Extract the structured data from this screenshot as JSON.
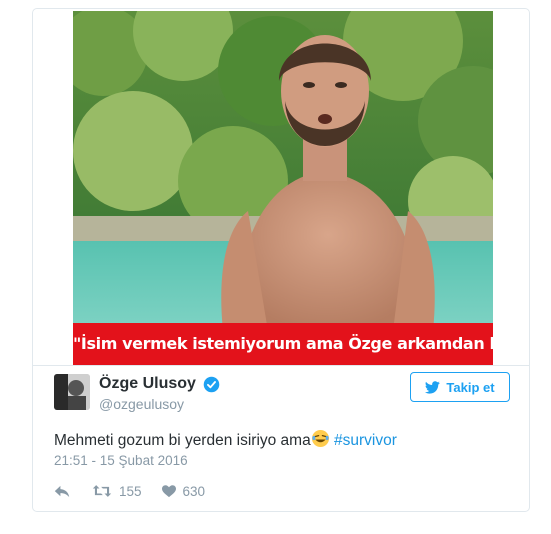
{
  "media": {
    "caption": "\"İsim vermek istemiyorum ama Özge arkamdan konuşmuş.\""
  },
  "author": {
    "name": "Özge Ulusoy",
    "handle": "@ozgeulusoy",
    "verified": true
  },
  "follow_button": {
    "label": "Takip et",
    "icon": "twitter-bird-icon"
  },
  "tweet": {
    "text": "Mehmeti gozum bi yerden isiriyo ama",
    "emoji": "😂",
    "hashtag": "#survivor",
    "timestamp": "21:51 - 15 Şubat 2016"
  },
  "actions": {
    "reply_icon": "reply-icon",
    "retweet_icon": "retweet-icon",
    "retweets": "155",
    "like_icon": "heart-icon",
    "likes": "630"
  },
  "colors": {
    "accent": "#1da1f2",
    "hashtag": "#1b95e0",
    "caption_bg": "#e3121b",
    "muted": "#8899a6",
    "text": "#292f33"
  }
}
